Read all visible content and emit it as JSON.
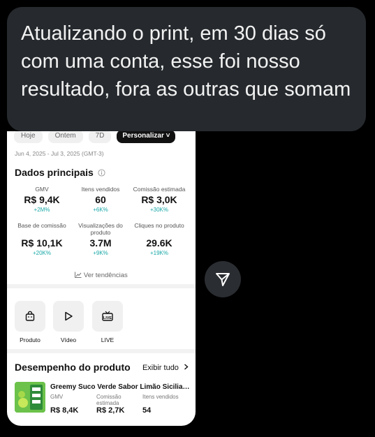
{
  "message": {
    "text": "Atualizando o print, em 30 dias só com uma conta, esse foi nosso resultado, fora as outras que somam"
  },
  "filters": [
    "Hoje",
    "Ontem",
    "7D"
  ],
  "filter_active": "Personalizar ˅",
  "date_range": "Jun 4, 2025 - Jul 3, 2025 (GMT-3)",
  "main_title": "Dados principais",
  "metrics": [
    {
      "label": "GMV",
      "value": "R$ 9,4K",
      "delta": "+2M%"
    },
    {
      "label": "Itens vendidos",
      "value": "60",
      "delta": "+6K%"
    },
    {
      "label": "Comissão estimada",
      "value": "R$ 3,0K",
      "delta": "+30K%"
    },
    {
      "label": "Base de comissão",
      "value": "R$ 10,1K",
      "delta": "+20K%"
    },
    {
      "label": "Visualizações do produto",
      "value": "3.7M",
      "delta": "+9K%"
    },
    {
      "label": "Cliques no produto",
      "value": "29.6K",
      "delta": "+19K%"
    }
  ],
  "trend_link": "Ver tendências",
  "quick_actions": [
    {
      "label": "Produto",
      "icon": "bag-icon"
    },
    {
      "label": "Vídeo",
      "icon": "play-icon"
    },
    {
      "label": "LIVE",
      "icon": "live-tv-icon"
    }
  ],
  "product_section": {
    "title": "Desempenho do produto",
    "see_all": "Exibir tudo",
    "product": {
      "name": "Greemy Suco Verde Sabor Limão Sicilian...",
      "labels": {
        "gmv": "GMV",
        "commission": "Comissão estimada",
        "items": "Itens vendidos"
      },
      "values": {
        "gmv": "R$ 8,4K",
        "commission": "R$ 2,7K",
        "items": "54"
      }
    }
  },
  "colors": {
    "accent_delta": "#1aa7a7",
    "bubble": "#262a2e"
  }
}
